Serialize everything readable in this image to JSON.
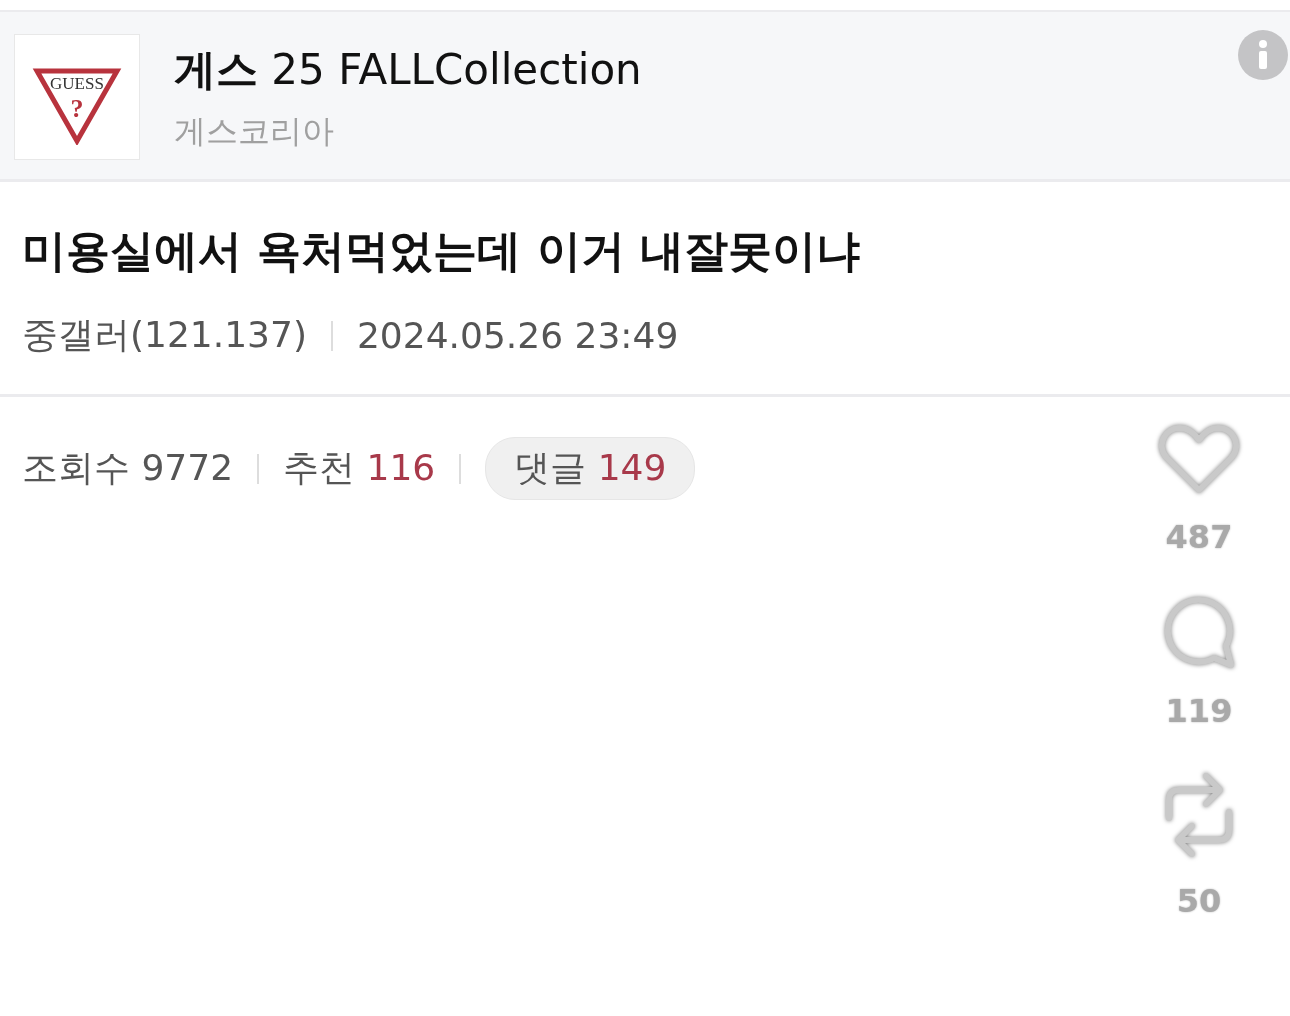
{
  "ad": {
    "logo_text": "GUESS",
    "logo_mark": "?",
    "title": "**게스** 25 FALLCollection",
    "advertiser": "게스코리아"
  },
  "post": {
    "title": "미용실에서 욕처먹었는데 이거 내잘못이냐",
    "author": "중갤러(121.137)",
    "date": "2024.05.26 23:49"
  },
  "stats": [
    {
      "kind": "plain",
      "label": "조회수",
      "value": "9772"
    },
    {
      "kind": "highlight",
      "label": "추천",
      "value": "116"
    },
    {
      "kind": "pill",
      "label": "댓글",
      "value": "149"
    }
  ],
  "actions": [
    {
      "kind": "like",
      "count": "487"
    },
    {
      "kind": "comment",
      "count": "119"
    },
    {
      "kind": "repost",
      "count": "50"
    }
  ]
}
